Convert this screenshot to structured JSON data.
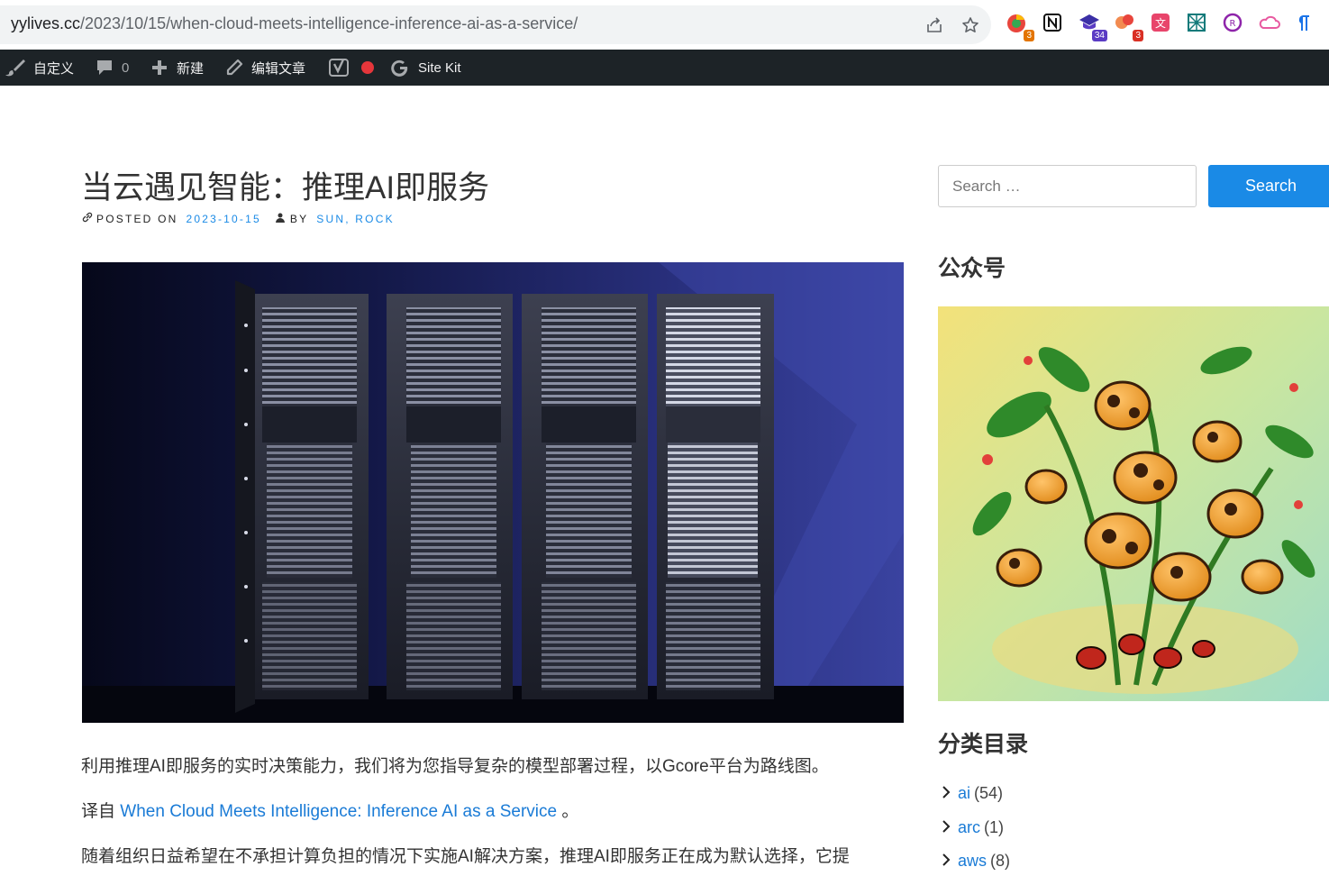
{
  "browser": {
    "url_host": "yylives.cc",
    "url_path": "/2023/10/15/when-cloud-meets-intelligence-inference-ai-as-a-service/",
    "extensions": [
      {
        "name": "chrome-ext-1",
        "badge": "3",
        "badge_color": "#e37400"
      },
      {
        "name": "notion-ext",
        "badge": ""
      },
      {
        "name": "edu-ext",
        "badge": "34",
        "badge_color": "#5b3cc4"
      },
      {
        "name": "clips-ext",
        "badge": "3",
        "badge_color": "#d93025"
      },
      {
        "name": "translate-ext",
        "badge": ""
      },
      {
        "name": "grid-ext",
        "badge": ""
      },
      {
        "name": "coin-ext",
        "badge": ""
      },
      {
        "name": "cloud-ext",
        "badge": ""
      },
      {
        "name": "paragraph-ext",
        "badge": ""
      }
    ]
  },
  "adminbar": {
    "customize": "自定义",
    "comments_count": "0",
    "new": "新建",
    "edit_post": "编辑文章",
    "site_kit": "Site Kit"
  },
  "post": {
    "title": "当云遇见智能：推理AI即服务",
    "posted_on_label": "POSTED ON",
    "date": "2023-10-15",
    "by_label": "BY",
    "author": "SUN, ROCK",
    "para1": "利用推理AI即服务的实时决策能力，我们将为您指导复杂的模型部署过程，以Gcore平台为路线图。",
    "para2_prefix": "译自",
    "para2_link": "When Cloud Meets Intelligence: Inference AI as a Service",
    "para2_suffix": "。",
    "para3": "随着组织日益希望在不承担计算负担的情况下实施AI解决方案，推理AI即服务正在成为默认选择，它提"
  },
  "sidebar": {
    "search_placeholder": "Search …",
    "search_button": "Search",
    "wechat_title": "公众号",
    "categories_title": "分类目录",
    "categories": [
      {
        "name": "ai",
        "count": "(54)"
      },
      {
        "name": "arc",
        "count": "(1)"
      },
      {
        "name": "aws",
        "count": "(8)"
      }
    ]
  },
  "colors": {
    "accent": "#1a8ae6",
    "link": "#1a7bd6",
    "adminbar_bg": "#1d2327",
    "recording_dot": "#e5363b"
  }
}
